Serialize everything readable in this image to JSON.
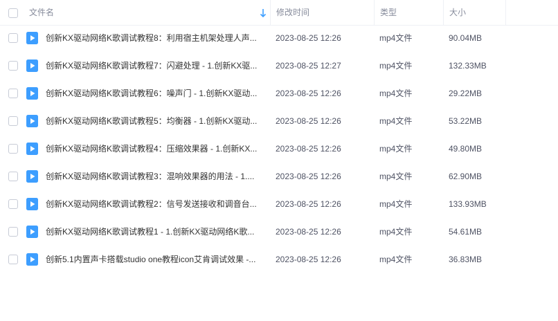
{
  "header": {
    "name_label": "文件名",
    "time_label": "修改时间",
    "type_label": "类型",
    "size_label": "大小",
    "sort_icon": "arrow-down-icon"
  },
  "colors": {
    "header_text": "#878c9c",
    "divider": "#eef0f5",
    "file_icon": "#3d9eff",
    "text": "#333333"
  },
  "files": [
    {
      "name": "创新KX驱动网络K歌调试教程8：利用宿主机架处理人声...",
      "time": "2023-08-25 12:26",
      "type": "mp4文件",
      "size": "90.04MB"
    },
    {
      "name": "创新KX驱动网络K歌调试教程7：闪避处理 - 1.创新KX驱...",
      "time": "2023-08-25 12:27",
      "type": "mp4文件",
      "size": "132.33MB"
    },
    {
      "name": "创新KX驱动网络K歌调试教程6：噪声门 - 1.创新KX驱动...",
      "time": "2023-08-25 12:26",
      "type": "mp4文件",
      "size": "29.22MB"
    },
    {
      "name": "创新KX驱动网络K歌调试教程5：均衡器 - 1.创新KX驱动...",
      "time": "2023-08-25 12:26",
      "type": "mp4文件",
      "size": "53.22MB"
    },
    {
      "name": "创新KX驱动网络K歌调试教程4：压缩效果器 - 1.创新KX...",
      "time": "2023-08-25 12:26",
      "type": "mp4文件",
      "size": "49.80MB"
    },
    {
      "name": "创新KX驱动网络K歌调试教程3：混响效果器的用法 - 1....",
      "time": "2023-08-25 12:26",
      "type": "mp4文件",
      "size": "62.90MB"
    },
    {
      "name": "创新KX驱动网络K歌调试教程2：信号发送接收和调音台...",
      "time": "2023-08-25 12:26",
      "type": "mp4文件",
      "size": "133.93MB"
    },
    {
      "name": "创新KX驱动网络K歌调试教程1 - 1.创新KX驱动网络K歌...",
      "time": "2023-08-25 12:26",
      "type": "mp4文件",
      "size": "54.61MB"
    },
    {
      "name": "创新5.1内置声卡搭载studio one教程icon艾肯调试效果 -...",
      "time": "2023-08-25 12:26",
      "type": "mp4文件",
      "size": "36.83MB"
    }
  ]
}
